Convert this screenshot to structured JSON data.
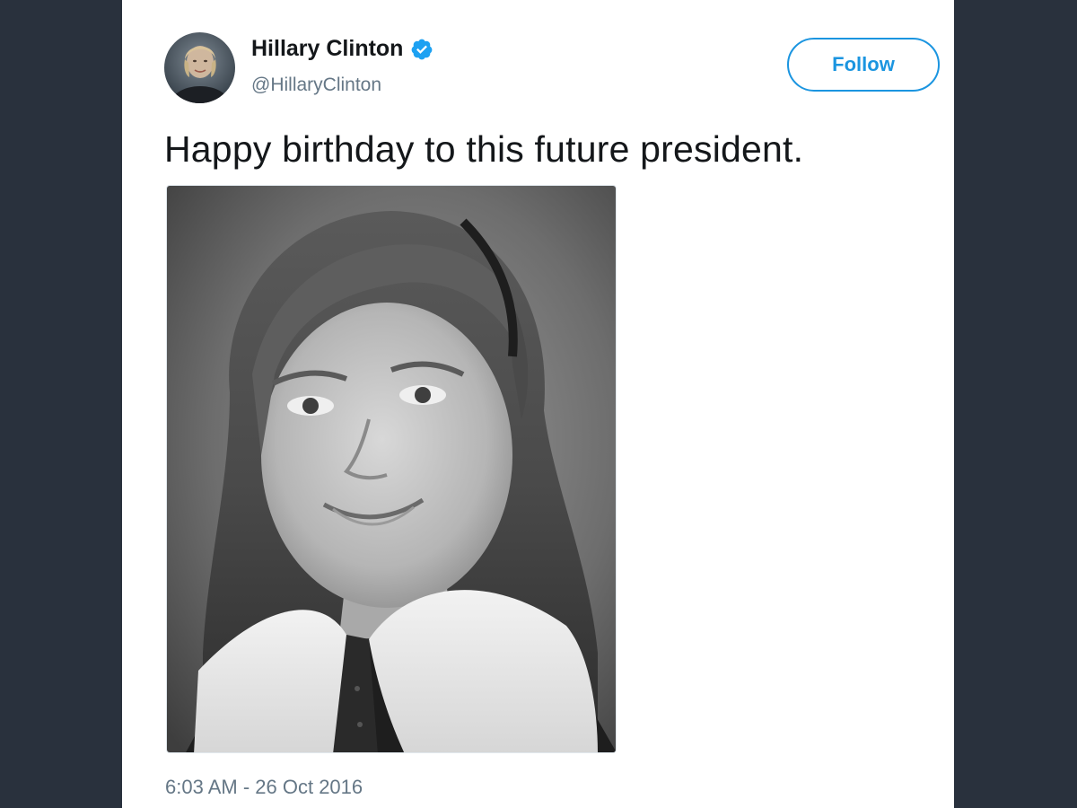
{
  "tweet": {
    "author": {
      "name": "Hillary Clinton",
      "handle": "@HillaryClinton",
      "verified": true,
      "avatar_icon": "avatar-photo"
    },
    "follow_label": "Follow",
    "text": "Happy birthday to this future president.",
    "photo": {
      "icon": "childhood-portrait-photo"
    },
    "timestamp": "6:03 AM - 26 Oct 2016"
  },
  "colors": {
    "background": "#29313d",
    "card": "#ffffff",
    "accent": "#1b95e0",
    "text_primary": "#14171a",
    "text_secondary": "#657786"
  }
}
